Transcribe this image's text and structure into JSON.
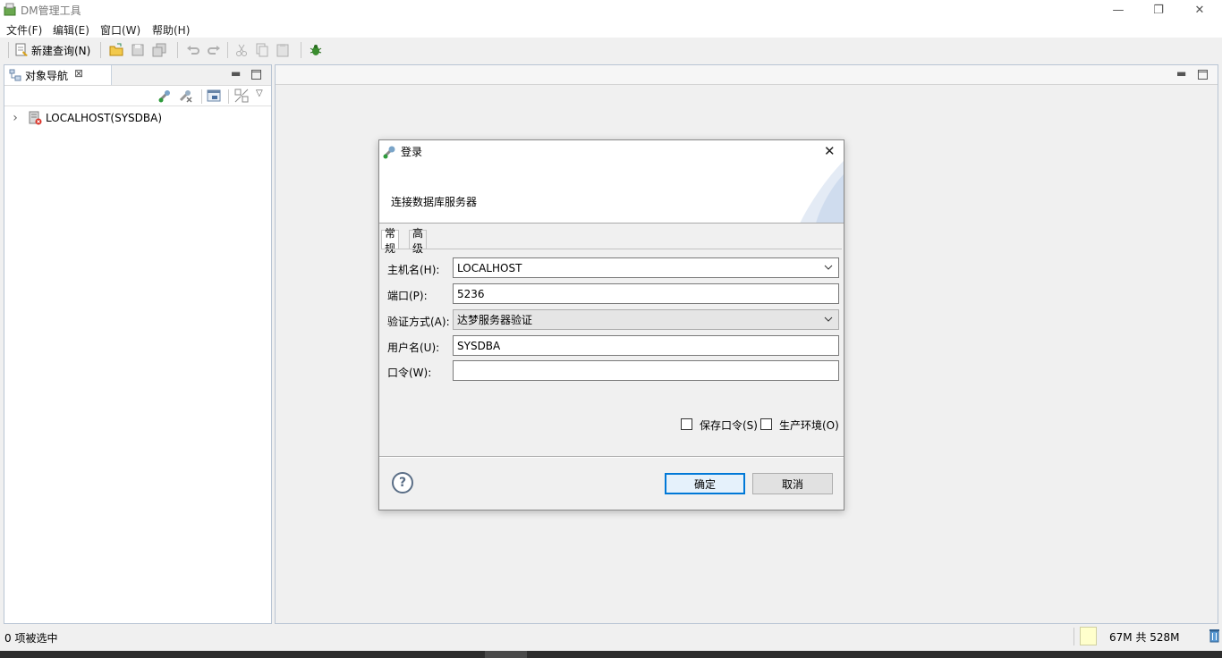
{
  "window": {
    "title": "DM管理工具",
    "minimize_glyph": "—",
    "restore_glyph": "❐",
    "close_glyph": "✕"
  },
  "menu": [
    "文件(F)",
    "编辑(E)",
    "窗口(W)",
    "帮助(H)"
  ],
  "toolbar": {
    "new_query_label": "新建查询(N)"
  },
  "navigator": {
    "tab_label": "对象导航",
    "tab_close_glyph": "⊠",
    "tree": [
      {
        "label": "LOCALHOST(SYSDBA)",
        "expander": "›"
      }
    ]
  },
  "statusbar": {
    "selection_text": "0 项被选中",
    "memory_text": "67M 共 528M"
  },
  "dialog": {
    "title": "登录",
    "subtitle": "连接数据库服务器",
    "close_glyph": "✕",
    "tabs": [
      "常规",
      "高级"
    ],
    "fields": {
      "host": {
        "label": "主机名(H):",
        "value": "LOCALHOST"
      },
      "port": {
        "label": "端口(P):",
        "value": "5236"
      },
      "auth": {
        "label": "验证方式(A):",
        "value": "达梦服务器验证"
      },
      "user": {
        "label": "用户名(U):",
        "value": "SYSDBA"
      },
      "password": {
        "label": "口令(W):",
        "value": ""
      }
    },
    "save_password_label": "保存口令(S)",
    "production_label": "生产环境(O)",
    "help_glyph": "?",
    "ok_label": "确定",
    "cancel_label": "取消"
  }
}
